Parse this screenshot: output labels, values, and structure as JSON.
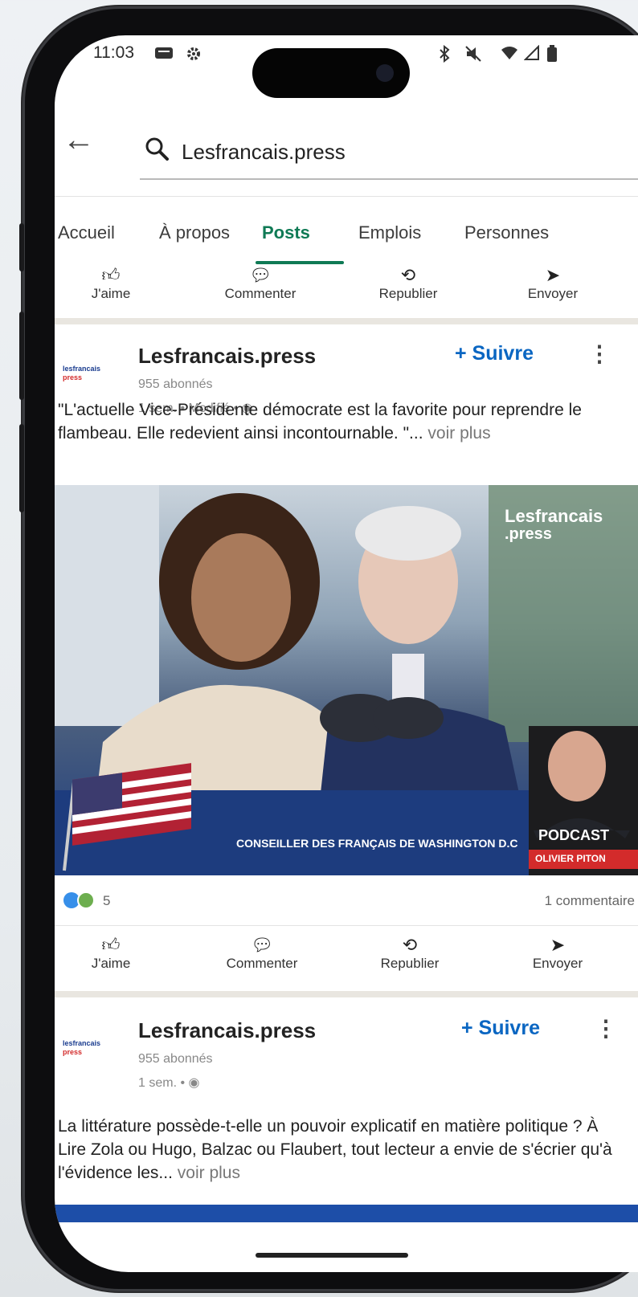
{
  "status_bar": {
    "time": "11:03",
    "icons": [
      "message-icon",
      "settings-icon",
      "bluetooth-icon",
      "mute-icon",
      "wifi-icon",
      "signal-icon",
      "battery-icon"
    ]
  },
  "search": {
    "query": "Lesfrancais.press"
  },
  "tabs": [
    "Accueil",
    "À propos",
    "Posts",
    "Emplois",
    "Personnes"
  ],
  "active_tab": "Posts",
  "actions": {
    "like": "J'aime",
    "comment": "Commenter",
    "repost": "Republier",
    "send": "Envoyer"
  },
  "posts": [
    {
      "logo_text_top": "lesfrancais",
      "logo_text_bottom": "press",
      "author": "Lesfrancais.press",
      "followers": "955 abonnés",
      "meta": "1 sem. • Modifié •",
      "follow_label": "+ Suivre",
      "text": "\"L'actuelle Vice-Présidente démocrate est la favorite pour reprendre le flambeau. Elle redevient ainsi incontournable. \"...",
      "see_more": "voir plus",
      "image": {
        "brand_line1": "Lesfrancais",
        "brand_line2": ".press",
        "banner": "CONSEILLER DES FRANÇAIS DE WASHINGTON D.C",
        "podcast": "PODCAST",
        "host": "OLIVIER PITON"
      },
      "reactions_count": "5",
      "comments": "1 commentaire"
    },
    {
      "logo_text_top": "lesfrancais",
      "logo_text_bottom": "press",
      "author": "Lesfrancais.press",
      "followers": "955 abonnés",
      "meta": "1 sem. •",
      "follow_label": "+ Suivre",
      "text": "La littérature possède-t-elle un pouvoir explicatif en matière politique ? À Lire Zola ou Hugo, Balzac ou Flaubert, tout lecteur a envie de s'écrier qu'à l'évidence les...",
      "see_more": "voir plus"
    }
  ],
  "colors": {
    "accent_green": "#0f7a55",
    "link_blue": "#0a66c2",
    "banner_blue": "#1d3c7e",
    "podcast_red": "#d32b2b"
  }
}
